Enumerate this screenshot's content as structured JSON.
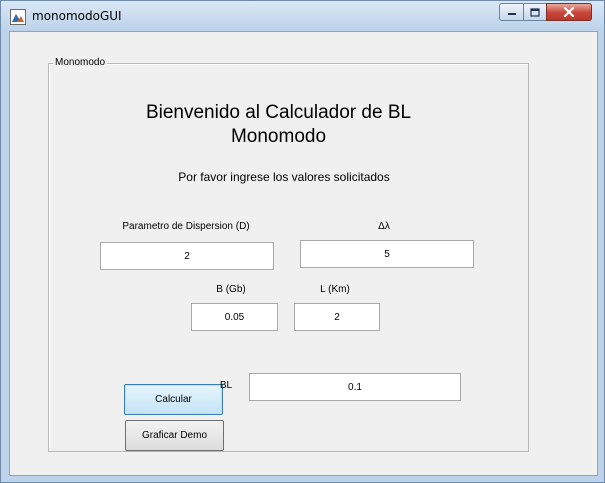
{
  "window": {
    "title": "monomodoGUI",
    "icon": "matlab-figure-icon",
    "controls": [
      "minimize-icon",
      "maximize-icon",
      "close-icon"
    ]
  },
  "panel": {
    "legend": "Monomodo",
    "heading_line1": "Bienvenido al Calculador de BL",
    "heading_line2": "Monomodo",
    "instruction": "Por favor ingrese los valores solicitados"
  },
  "inputs": {
    "dispersion_label": "Parametro de Dispersion (D)",
    "dispersion_value": "2",
    "delta_lambda_label": "Δλ",
    "delta_lambda_value": "5",
    "b_label": "B (Gb)",
    "b_value": "0.05",
    "l_label": "L (Km)",
    "l_value": "2"
  },
  "actions": {
    "calculate_label": "Calcular",
    "demo_label": "Graficar Demo"
  },
  "result": {
    "label": "BL",
    "value": "0.1"
  },
  "colors": {
    "titlebar": "#bcd3ea",
    "background": "#f0f0f0",
    "close_button": "#c8463a",
    "focused_button": "#c3e4f6"
  }
}
